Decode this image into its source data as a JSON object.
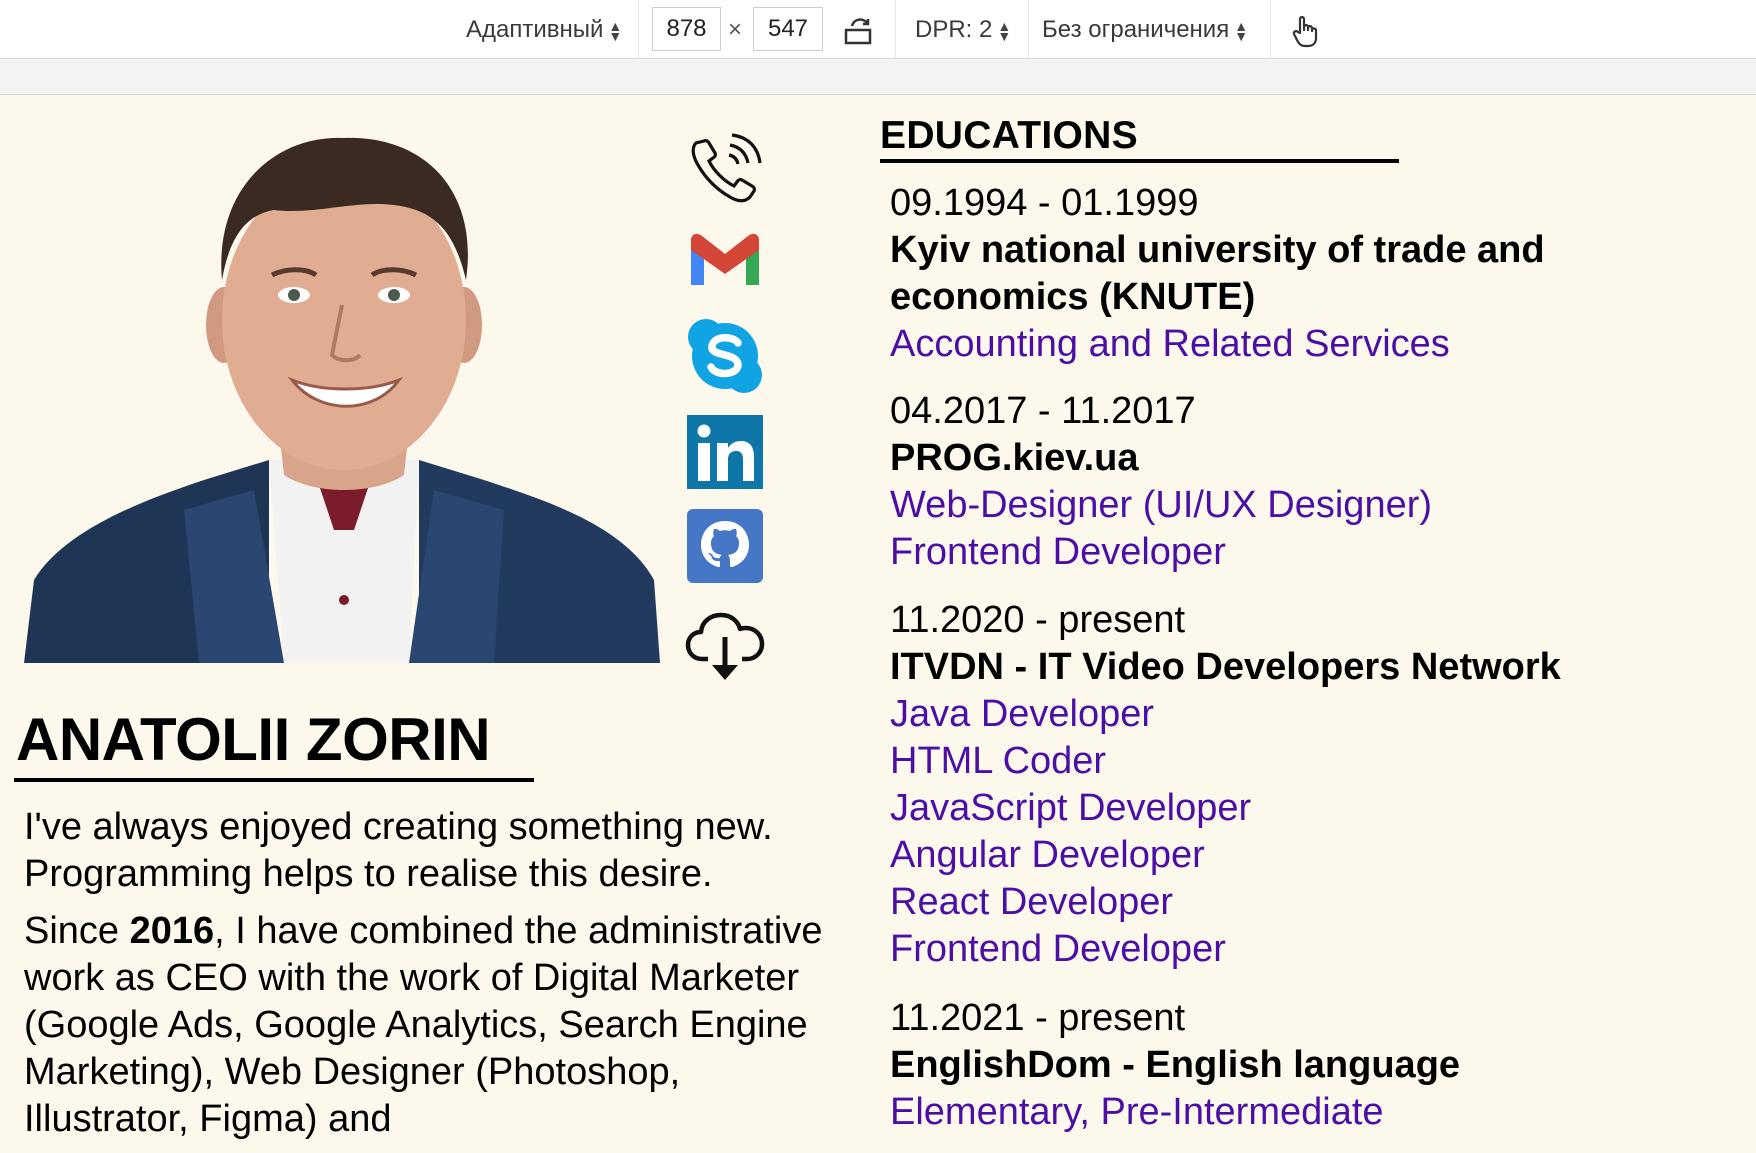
{
  "devtools": {
    "device_mode": "Адаптивный",
    "width": "878",
    "times": "×",
    "height": "547",
    "dpr": "DPR: 2",
    "throttling": "Без ограничения"
  },
  "icons": {
    "phone": "phone-icon",
    "gmail": "gmail-icon",
    "skype": "skype-icon",
    "linkedin": "linkedin-icon",
    "github": "github-icon",
    "download": "cloud-download-icon"
  },
  "profile": {
    "name": "ANATOLII ZORIN",
    "about_1": "I've always enjoyed creating something new. Programming helps to realise this desire.",
    "about_2_before": "Since ",
    "about_2_year": "2016",
    "about_2_after": ", I have combined the administrative work as CEO with the work of Digital Marketer (Google Ads, Google Analytics, Search Engine Marketing), Web Designer (Photoshop, Illustrator, Figma) and"
  },
  "educations": {
    "title": "EDUCATIONS",
    "entries": [
      {
        "date": "09.1994 - 01.1999",
        "school": "Kyiv national university of trade and economics (KNUTE)",
        "courses": [
          "Accounting and Related Services"
        ]
      },
      {
        "date": "04.2017 - 11.2017",
        "school": "PROG.kiev.ua",
        "courses": [
          "Web-Designer (UI/UX Designer)",
          "Frontend Developer"
        ]
      },
      {
        "date": "11.2020 - present",
        "school": "ITVDN - IT Video Developers Network",
        "courses": [
          "Java Developer",
          "HTML Coder",
          "JavaScript Developer",
          "Angular Developer",
          "React Developer",
          "Frontend Developer"
        ]
      },
      {
        "date": "11.2021 - present",
        "school": "EnglishDom - English language",
        "courses_inline": [
          "Elementary",
          "Pre-Intermediate"
        ],
        "separator": ", "
      }
    ]
  },
  "colors": {
    "page_bg": "#fdf8ec",
    "link": "#4b0fa6",
    "gmail_red": "#d44638",
    "skype_blue": "#10a4e5",
    "linkedin_blue": "#0e76a8",
    "github_blue": "#4577c6"
  }
}
